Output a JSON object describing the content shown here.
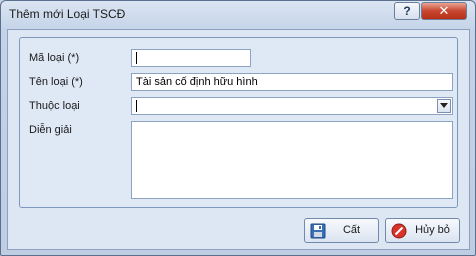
{
  "window": {
    "title": "Thêm mới Loại TSCĐ",
    "help_label": "?",
    "close_label": "✕"
  },
  "form": {
    "ma_loai": {
      "label": "Mã loại (*)",
      "value": ""
    },
    "ten_loai": {
      "label": "Tên loại (*)",
      "value": "Tài sản cố định hữu hình"
    },
    "thuoc_loai": {
      "label": "Thuộc loại",
      "value": ""
    },
    "dien_giai": {
      "label": "Diễn giải",
      "value": ""
    }
  },
  "buttons": {
    "save_label": "Cất",
    "cancel_label": "Hủy bỏ"
  },
  "icons": {
    "save": "floppy-disk-icon",
    "cancel": "cancel-circle-icon",
    "dropdown": "chevron-down-icon"
  }
}
